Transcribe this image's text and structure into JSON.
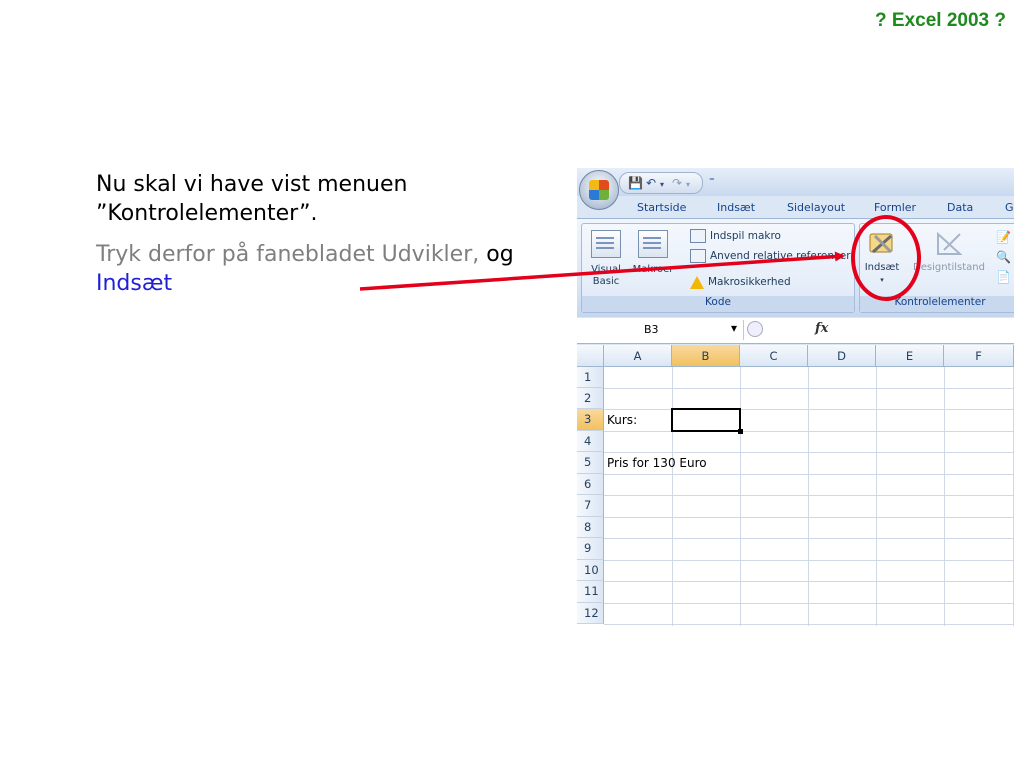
{
  "corner_title": "? Excel 2003 ?",
  "instructions": {
    "line1_a": "Nu skal vi have vist menuen",
    "line1_b": "”Kontrolelementer”.",
    "line2_gray": "Tryk derfor på fanebladet Udvikler,",
    "line2_black": "og",
    "line2_blue": "Indsæt"
  },
  "excel": {
    "qat_sep": "⁼",
    "tabs": [
      "Startside",
      "Indsæt",
      "Sidelayout",
      "Formler",
      "Data",
      "G"
    ],
    "ribbon": {
      "kode_group": {
        "label": "Kode",
        "visual_basic": "Visual Basic",
        "makroer": "Makroer",
        "indspil_makro": "Indspil makro",
        "relative_ref": "Anvend relative referencer",
        "makrosikkerhed": "Makrosikkerhed"
      },
      "kontrol_group": {
        "label": "Kontrolelementer",
        "indsaet": "Indsæt",
        "designtilstand": "Designtilstand"
      }
    },
    "namebox": "B3",
    "fx": "fx",
    "columns": [
      "A",
      "B",
      "C",
      "D",
      "E",
      "F"
    ],
    "rows": [
      "1",
      "2",
      "3",
      "4",
      "5",
      "6",
      "7",
      "8",
      "9",
      "10",
      "11",
      "12"
    ],
    "cells": {
      "A3": "Kurs:",
      "A5": "Pris for 130 Euro"
    },
    "selected_cell": "B3"
  },
  "colors": {
    "title_green": "#1e8a1e",
    "highlight_red": "#e3001b",
    "link_blue": "#1f1fd6",
    "gray_text": "#7f7f7f"
  }
}
